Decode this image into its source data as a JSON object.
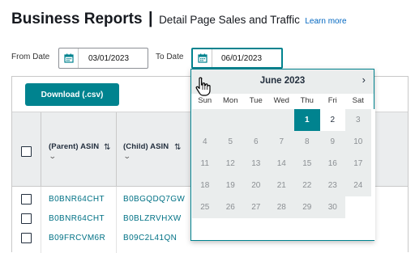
{
  "header": {
    "title": "Business Reports",
    "separator": "|",
    "subtitle": "Detail Page Sales and Traffic",
    "learn_more": "Learn more"
  },
  "date_filter": {
    "from_label": "From Date",
    "from_value": "03/01/2023",
    "to_label": "To Date",
    "to_value": "06/01/2023"
  },
  "toolbar": {
    "download_label": "Download (.csv)"
  },
  "table": {
    "columns": [
      "(Parent) ASIN",
      "(Child) ASIN"
    ],
    "rows": [
      {
        "parent": "B0BNR64CHT",
        "child": "B0BGQDQ7GW"
      },
      {
        "parent": "B0BNR64CHT",
        "child": "B0BLZRVHXW"
      },
      {
        "parent": "B09FRCVM6R",
        "child": "B09C2L41QN"
      }
    ]
  },
  "calendar": {
    "month_label": "June 2023",
    "weekdays": [
      "Sun",
      "Mon",
      "Tue",
      "Wed",
      "Thu",
      "Fri",
      "Sat"
    ],
    "selected_day": "1",
    "days": [
      "1",
      "2",
      "3",
      "4",
      "5",
      "6",
      "7",
      "8",
      "9",
      "10",
      "11",
      "12",
      "13",
      "14",
      "15",
      "16",
      "17",
      "18",
      "19",
      "20",
      "21",
      "22",
      "23",
      "24",
      "25",
      "26",
      "27",
      "28",
      "29",
      "30"
    ],
    "available_days": [
      "1",
      "2"
    ]
  },
  "colors": {
    "accent": "#00838f",
    "link": "#007185",
    "header_bg": "#ebedee",
    "disabled_bg": "#eaeded"
  },
  "icons": {
    "calendar": "calendar-icon",
    "sort": "sort-icon",
    "chevron": "chevron-down-icon",
    "prev": "chevron-left-icon",
    "next": "chevron-right-icon",
    "cursor": "hand-pointer-icon"
  }
}
